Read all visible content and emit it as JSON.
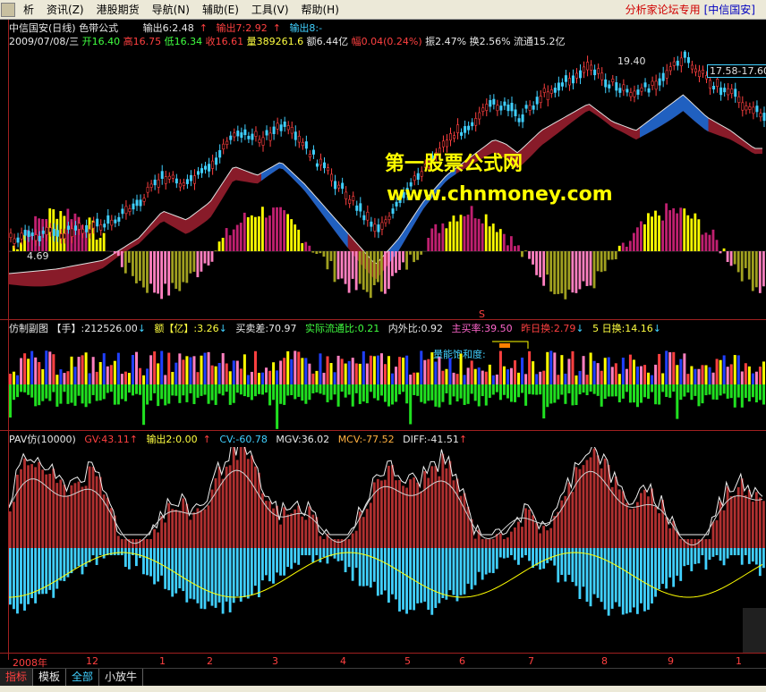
{
  "menu": {
    "items": [
      "析",
      "资讯(Z)",
      "港股期货",
      "导航(N)",
      "辅助(E)",
      "工具(V)",
      "帮助(H)"
    ],
    "forum": "分析家论坛专用",
    "broker": "[中信国安]"
  },
  "main": {
    "title": "中信国安(日线) 色带公式",
    "out6": "输出6:2.48",
    "out7": "输出7:2.92",
    "out8": "输出8:-",
    "date": "2009/07/08/三",
    "open": "开16.40",
    "high": "高16.75",
    "low": "低16.34",
    "close": "收16.61",
    "vol": "量389261.6",
    "amount": "额6.44亿",
    "change": "幅0.04(0.24%)",
    "amplitude": "振2.47%",
    "turnover": "换2.56%",
    "float": "流通15.2亿",
    "high_label": "19.40",
    "range_box": "17.58-17.60",
    "low_label": "4.69",
    "s_marker": "S"
  },
  "watermark": {
    "line1": "第一股票公式网",
    "line2": "www.chnmoney.com"
  },
  "sub1": {
    "title": "仿制副图",
    "hand": "【手】:212526.00",
    "amount": "额【亿】:3.26",
    "buysell": "买卖差:70.97",
    "float_ratio": "实际流通比:0.21",
    "inout": "内外比:0.92",
    "main_rate": "主买率:39.50",
    "yesterday_turn": "昨日换:2.79",
    "five_day_turn": "5 日换:14.16",
    "saturation": "量能饱和度:"
  },
  "sub2": {
    "title": "PAV仿(10000)",
    "gv": "GV:43.11",
    "out2": "输出2:0.00",
    "cv": "CV:-60.78",
    "mgv": "MGV:36.02",
    "mcv": "MCV:-77.52",
    "diff": "DIFF:-41.51"
  },
  "timeaxis": {
    "year": "2008年",
    "months": [
      "12",
      "1",
      "2",
      "3",
      "4",
      "5",
      "6",
      "7",
      "8",
      "9",
      "1"
    ]
  },
  "tabs": [
    "指标",
    "模板",
    "全部",
    "小放牛"
  ],
  "colors": {
    "up": "#ff4040",
    "down": "#40d0ff",
    "yellow": "#ffff00",
    "band_red": "#a02030",
    "band_blue": "#2060c0",
    "green": "#20e020"
  }
}
